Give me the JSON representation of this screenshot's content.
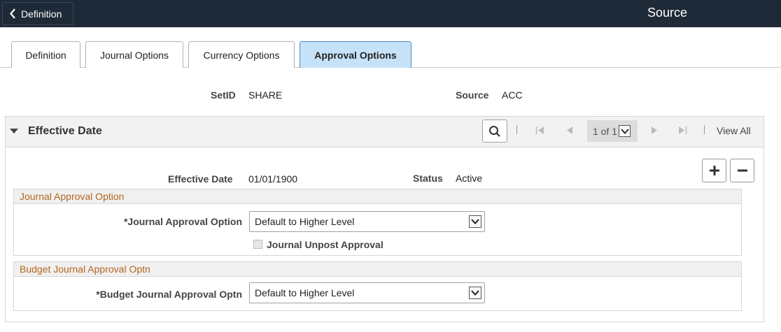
{
  "header": {
    "back_label": "Definition",
    "title": "Source"
  },
  "tabs": [
    {
      "label": "Definition",
      "active": false
    },
    {
      "label": "Journal Options",
      "active": false
    },
    {
      "label": "Currency Options",
      "active": false
    },
    {
      "label": "Approval Options",
      "active": true
    }
  ],
  "keys": {
    "setid_label": "SetID",
    "setid_value": "SHARE",
    "source_label": "Source",
    "source_value": "ACC"
  },
  "effective_date_grid": {
    "title": "Effective Date",
    "pager": "1 of 1",
    "view_all": "View All",
    "effective_date_label": "Effective Date",
    "effective_date_value": "01/01/1900",
    "status_label": "Status",
    "status_value": "Active"
  },
  "journal_approval": {
    "group_title": "Journal Approval Option",
    "field_label": "*Journal Approval Option",
    "selected": "Default to Higher Level",
    "unpost_label": "Journal Unpost Approval",
    "unpost_checked": false
  },
  "budget_approval": {
    "group_title": "Budget Journal Approval Optn",
    "field_label": "*Budget Journal Approval Optn",
    "selected": "Default to Higher Level"
  },
  "icons": {
    "back": "chevron-left-icon",
    "search": "search-icon",
    "add": "plus-icon",
    "delete": "minus-icon"
  },
  "colors": {
    "topbar": "#1f2a38",
    "active_tab": "#c6e2f8",
    "group_title": "#b5651d"
  }
}
